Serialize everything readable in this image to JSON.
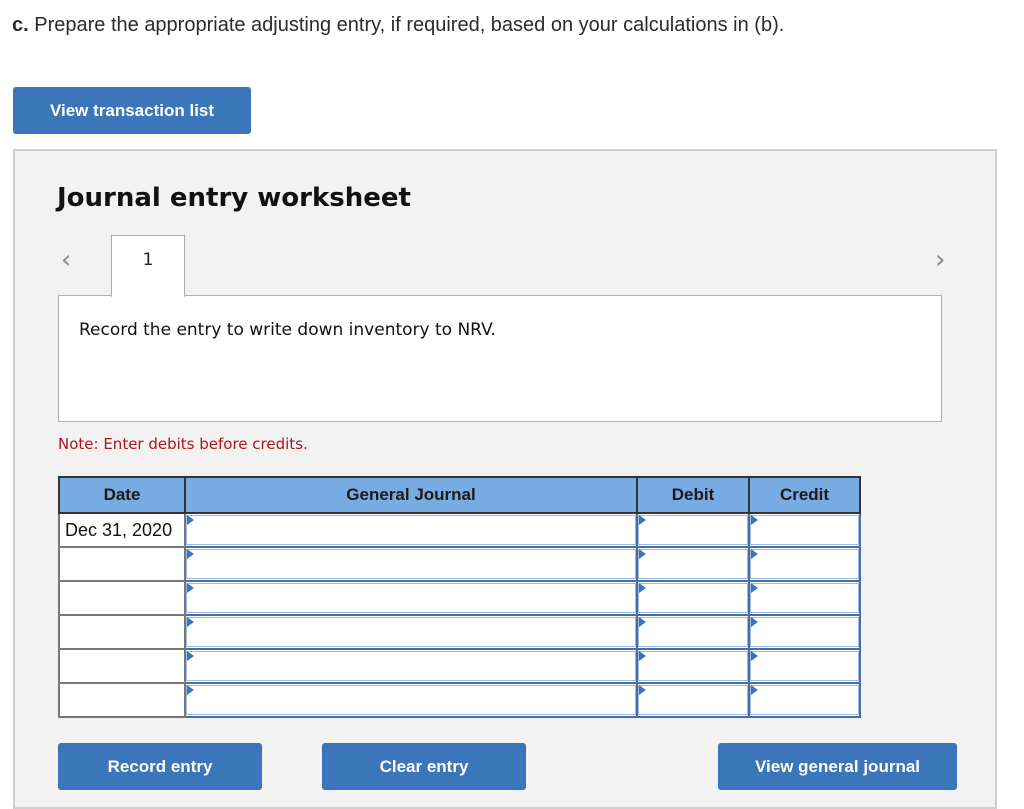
{
  "instruction": {
    "prefix": "c.",
    "text": " Prepare the appropriate adjusting entry, if required, based on your calculations in (b)."
  },
  "buttons": {
    "view_transaction_list": "View transaction list",
    "record_entry": "Record entry",
    "clear_entry": "Clear entry",
    "view_general_journal": "View general journal"
  },
  "worksheet": {
    "title": "Journal entry worksheet",
    "prev_icon": "chevron-left-icon",
    "next_icon": "chevron-right-icon",
    "prev_glyph": "‹",
    "next_glyph": "›",
    "tabs": [
      {
        "label": "1",
        "active": true
      }
    ],
    "description": "Record the entry to write down inventory to NRV.",
    "note": "Note: Enter debits before credits."
  },
  "journal": {
    "headers": {
      "date": "Date",
      "general_journal": "General Journal",
      "debit": "Debit",
      "credit": "Credit"
    },
    "rows": [
      {
        "date": "Dec 31, 2020",
        "account": "",
        "debit": "",
        "credit": ""
      },
      {
        "date": "",
        "account": "",
        "debit": "",
        "credit": ""
      },
      {
        "date": "",
        "account": "",
        "debit": "",
        "credit": ""
      },
      {
        "date": "",
        "account": "",
        "debit": "",
        "credit": ""
      },
      {
        "date": "",
        "account": "",
        "debit": "",
        "credit": ""
      },
      {
        "date": "",
        "account": "",
        "debit": "",
        "credit": ""
      }
    ]
  },
  "colors": {
    "button": "#3b76ba",
    "header": "#78abe2",
    "note": "#b0141c",
    "panel": "#f2f2f2"
  }
}
